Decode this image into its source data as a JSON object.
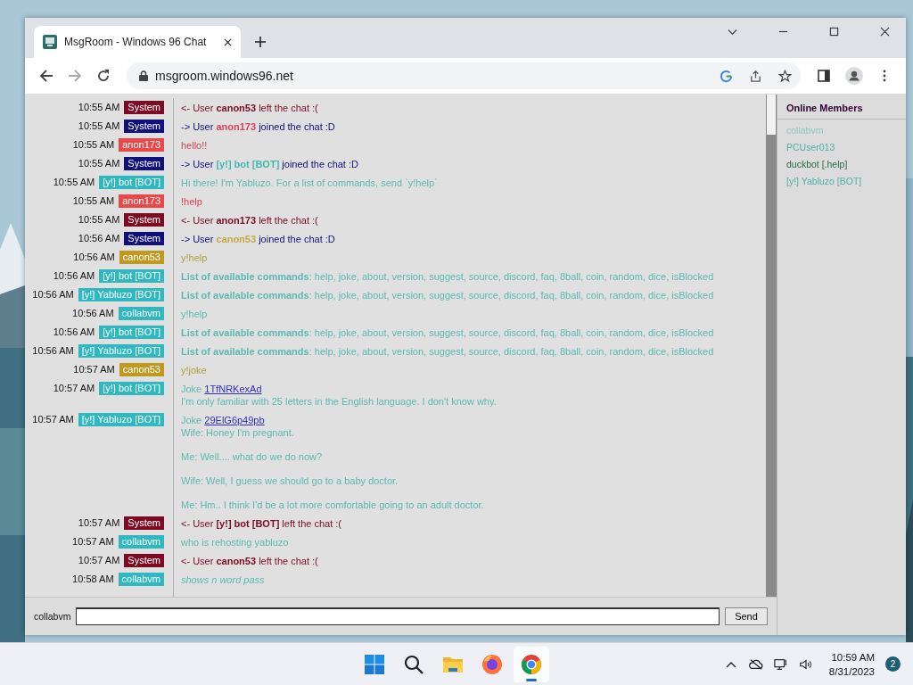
{
  "browser": {
    "tab_title": "MsgRoom - Windows 96 Chat",
    "url": "msgroom.windows96.net"
  },
  "messages": [
    {
      "time": "10:55 AM",
      "user": "System",
      "color": "#7d0a22",
      "kind": "event",
      "body": {
        "text": "<- User",
        "rest": "left the chat :(",
        "color": "#7d0a22"
      },
      "name": {
        "text": "canon53",
        "color": "#7d0a22"
      }
    },
    {
      "time": "10:55 AM",
      "user": "System",
      "color": "#10107a",
      "kind": "event",
      "body": {
        "text": "-> User",
        "rest": "joined the chat :D",
        "color": "#10107a"
      },
      "name": {
        "text": "anon173",
        "color": "#e04060"
      }
    },
    {
      "time": "10:55 AM",
      "user": "anon173",
      "color": "#e84848",
      "kind": "text",
      "body": {
        "text": "hello!!",
        "color": "#e04050",
        "italic": false
      }
    },
    {
      "time": "10:55 AM",
      "user": "System",
      "color": "#10107a",
      "kind": "event",
      "body": {
        "text": "-> User",
        "rest": "joined the chat :D",
        "color": "#10107a"
      },
      "name": {
        "text": "[y!] bot [BOT]",
        "color": "#40b8b0"
      }
    },
    {
      "time": "10:55 AM",
      "user": "[y!] bot [BOT]",
      "color": "#30b8c0",
      "kind": "text",
      "body": {
        "text": "Hi there! I'm Yabluzo. For a list of commands, send `y!help`",
        "color": "#5cbab2",
        "italic": false
      }
    },
    {
      "time": "10:55 AM",
      "user": "anon173",
      "color": "#e84848",
      "kind": "text",
      "body": {
        "text": "!help",
        "color": "#e04050",
        "italic": false
      }
    },
    {
      "time": "10:55 AM",
      "user": "System",
      "color": "#7d0a22",
      "kind": "event",
      "body": {
        "text": "<- User",
        "rest": "left the chat :(",
        "color": "#7d0a22"
      },
      "name": {
        "text": "anon173",
        "color": "#7d0a22"
      }
    },
    {
      "time": "10:56 AM",
      "user": "System",
      "color": "#10107a",
      "kind": "event",
      "body": {
        "text": "-> User",
        "rest": "joined the chat :D",
        "color": "#10107a"
      },
      "name": {
        "text": "canon53",
        "color": "#c8a840"
      }
    },
    {
      "time": "10:56 AM",
      "user": "canon53",
      "color": "#c09a20",
      "kind": "text",
      "body": {
        "text": "y!help",
        "color": "#b0a040",
        "italic": false
      }
    },
    {
      "time": "10:56 AM",
      "user": "[y!] bot [BOT]",
      "color": "#30b8c0",
      "kind": "rich",
      "body": {
        "text": "**List of available commands**: help, joke, about, version, suggest, source, discord, faq, 8ball, coin, random, dice, isBlocked",
        "color": "#5cbab2"
      }
    },
    {
      "time": "10:56 AM",
      "user": "[y!] Yabluzo [BOT]",
      "color": "#30b8c0",
      "kind": "rich",
      "body": {
        "text": "**List of available commands**: help, joke, about, version, suggest, source, discord, faq, 8ball, coin, random, dice, isBlocked",
        "color": "#5cbab2"
      }
    },
    {
      "time": "10:56 AM",
      "user": "collabvm",
      "color": "#30b8c0",
      "kind": "text",
      "body": {
        "text": "y!help",
        "color": "#5cbab2",
        "italic": false
      }
    },
    {
      "time": "10:56 AM",
      "user": "[y!] bot [BOT]",
      "color": "#30b8c0",
      "kind": "rich",
      "body": {
        "text": "**List of available commands**: help, joke, about, version, suggest, source, discord, faq, 8ball, coin, random, dice, isBlocked",
        "color": "#5cbab2"
      }
    },
    {
      "time": "10:56 AM",
      "user": "[y!] Yabluzo [BOT]",
      "color": "#30b8c0",
      "kind": "rich",
      "body": {
        "text": "**List of available commands**: help, joke, about, version, suggest, source, discord, faq, 8ball, coin, random, dice, isBlocked",
        "color": "#5cbab2"
      }
    },
    {
      "time": "10:57 AM",
      "user": "canon53",
      "color": "#c09a20",
      "kind": "text",
      "body": {
        "text": "y!joke",
        "color": "#b0a040",
        "italic": false
      }
    },
    {
      "time": "10:57 AM",
      "user": "[y!] bot [BOT]",
      "color": "#30b8c0",
      "kind": "joke",
      "body": {
        "text": "Joke",
        "link": "1TfNRKexAd",
        "lines": [
          "I'm only familiar with 25 letters in the English language. I don't know why."
        ],
        "color": "#5cbab2"
      }
    },
    {
      "time": "10:57 AM",
      "user": "[y!] Yabluzo [BOT]",
      "color": "#30b8c0",
      "kind": "joke",
      "body": {
        "text": "Joke",
        "link": "29ElG6p49pb",
        "lines": [
          "Wife: Honey I'm pregnant.",
          "Me: Well.... what do we do now?",
          "Wife: Well, I guess we should go to a baby doctor.",
          "Me: Hm.. I think I'd be a lot more comfortable going to an adult doctor."
        ],
        "color": "#5cbab2"
      }
    },
    {
      "time": "10:57 AM",
      "user": "System",
      "color": "#7d0a22",
      "kind": "event",
      "body": {
        "text": "<- User",
        "rest": "left the chat :(",
        "color": "#7d0a22"
      },
      "name": {
        "text": "[y!] bot [BOT]",
        "color": "#7d0a22"
      }
    },
    {
      "time": "10:57 AM",
      "user": "collabvm",
      "color": "#30b8c0",
      "kind": "text",
      "body": {
        "text": "who is rehosting yabluzo",
        "color": "#5cbab2",
        "italic": false
      }
    },
    {
      "time": "10:57 AM",
      "user": "System",
      "color": "#7d0a22",
      "kind": "event",
      "body": {
        "text": "<- User",
        "rest": "left the chat :(",
        "color": "#7d0a22"
      },
      "name": {
        "text": "canon53",
        "color": "#7d0a22"
      }
    },
    {
      "time": "10:58 AM",
      "user": "collabvm",
      "color": "#30b8c0",
      "kind": "text",
      "body": {
        "text": "shows n word pass",
        "color": "#5cbab2",
        "italic": true
      }
    }
  ],
  "members": {
    "title": "Online Members",
    "items": [
      {
        "name": "collabvm",
        "color": "#8cc8c0"
      },
      {
        "name": "PCUser013",
        "color": "#50b0a8"
      },
      {
        "name": "duckbot [.help]",
        "color": "#2a6a4a"
      },
      {
        "name": "[y!] Yabluzo [BOT]",
        "color": "#50b0a8"
      }
    ]
  },
  "composer": {
    "user": "collabvm",
    "send": "Send"
  },
  "taskbar": {
    "apps": [
      {
        "kind": "start",
        "active": false
      },
      {
        "kind": "search",
        "active": false
      },
      {
        "kind": "folder",
        "active": false
      },
      {
        "kind": "firefox",
        "active": false
      },
      {
        "kind": "chrome",
        "active": true
      }
    ],
    "time": "10:59 AM",
    "date": "8/31/2023",
    "notifications": "2"
  }
}
